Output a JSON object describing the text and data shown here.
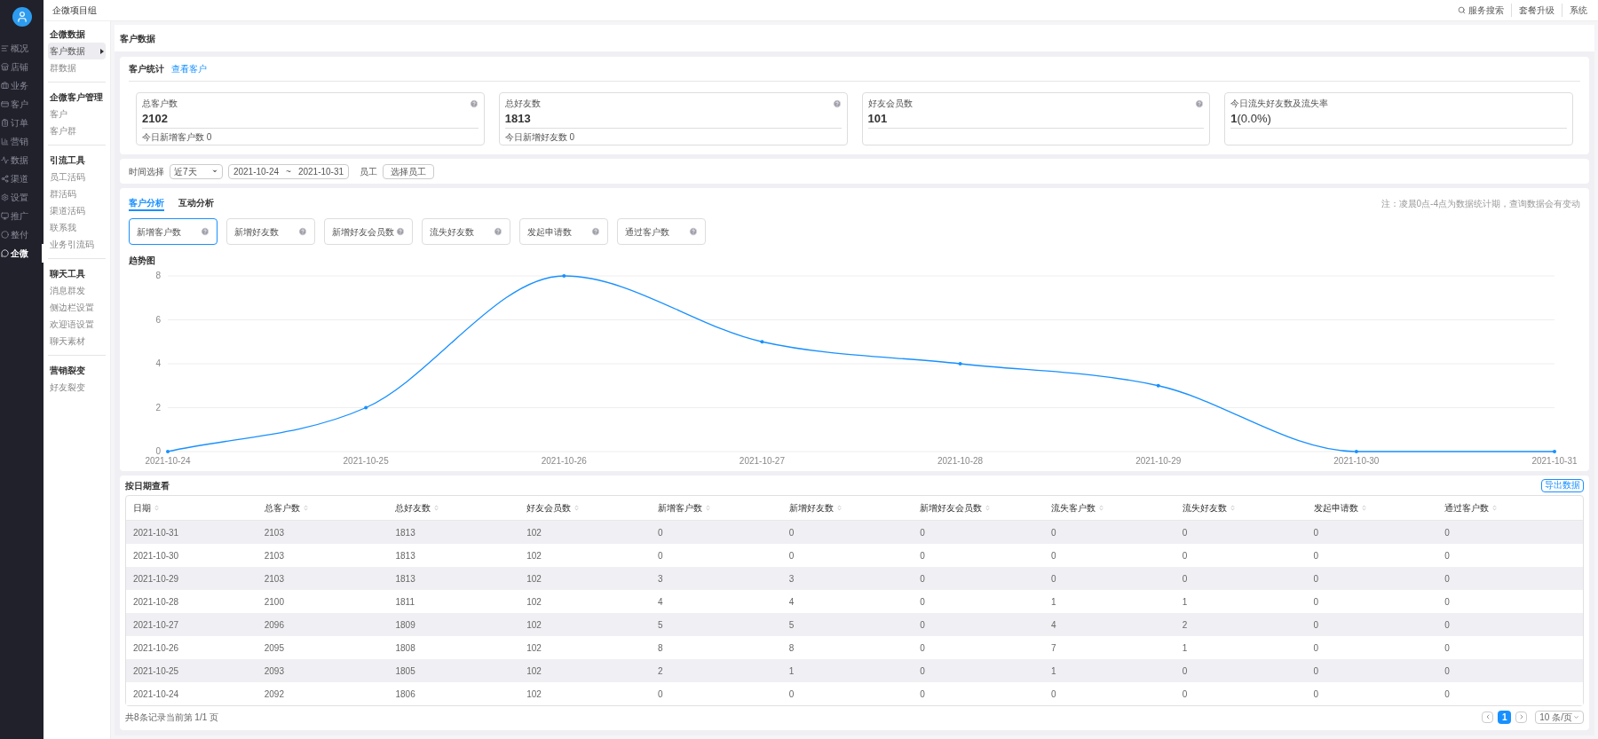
{
  "app_sidebar": {
    "items": [
      {
        "label": "概况",
        "selected": false
      },
      {
        "label": "店铺",
        "selected": false
      },
      {
        "label": "业务",
        "selected": false
      },
      {
        "label": "客户",
        "selected": false
      },
      {
        "label": "订单",
        "selected": false
      },
      {
        "label": "营销",
        "selected": false
      },
      {
        "label": "数据",
        "selected": false
      },
      {
        "label": "渠道",
        "selected": false
      },
      {
        "label": "设置",
        "selected": false
      },
      {
        "label": "推广",
        "selected": false
      },
      {
        "label": "整付",
        "selected": false
      },
      {
        "label": "企微",
        "selected": true
      }
    ]
  },
  "topbar": {
    "title": "企微项目组",
    "links": [
      "服务搜索",
      "套餐升级",
      "系统"
    ]
  },
  "sub_sidebar": {
    "groups": [
      {
        "title": "企微数据",
        "items": [
          {
            "label": "客户数据",
            "selected": true
          },
          {
            "label": "群数据",
            "selected": false
          }
        ]
      },
      {
        "title": "企微客户管理",
        "items": [
          {
            "label": "客户",
            "selected": false
          },
          {
            "label": "客户群",
            "selected": false
          }
        ]
      },
      {
        "title": "引流工具",
        "items": [
          {
            "label": "员工活码",
            "selected": false
          },
          {
            "label": "群活码",
            "selected": false
          },
          {
            "label": "渠道活码",
            "selected": false
          },
          {
            "label": "联系我",
            "selected": false
          },
          {
            "label": "业务引流码",
            "selected": false
          }
        ]
      },
      {
        "title": "聊天工具",
        "items": [
          {
            "label": "消息群发",
            "selected": false
          },
          {
            "label": "侧边栏设置",
            "selected": false
          },
          {
            "label": "欢迎语设置",
            "selected": false
          },
          {
            "label": "聊天素材",
            "selected": false
          }
        ]
      },
      {
        "title": "营销裂变",
        "items": [
          {
            "label": "好友裂变",
            "selected": false
          }
        ]
      }
    ]
  },
  "page_title": "客户数据",
  "stats": {
    "title": "客户统计",
    "link": "查看客户",
    "cards": [
      {
        "label": "总客户数",
        "value": "2102",
        "sub": "今日新增客户数 0",
        "help": true
      },
      {
        "label": "总好友数",
        "value": "1813",
        "sub": "今日新增好友数 0",
        "help": true
      },
      {
        "label": "好友会员数",
        "value": "101",
        "help": true
      },
      {
        "label": "今日流失好友数及流失率",
        "value": "1",
        "rate": "(0.0%)",
        "help": false
      }
    ]
  },
  "filter": {
    "time_label": "时间选择",
    "period": "近7天",
    "start_date": "2021-10-24",
    "separator": "~",
    "end_date": "2021-10-31",
    "staff_label": "员工",
    "staff_button": "选择员工"
  },
  "analysis": {
    "tabs": [
      {
        "label": "客户分析",
        "selected": true
      },
      {
        "label": "互动分析",
        "selected": false
      }
    ],
    "note": "注：凌晨0点-4点为数据统计期，查询数据会有变动",
    "metrics": [
      {
        "label": "新增客户数",
        "selected": true
      },
      {
        "label": "新增好友数",
        "selected": false
      },
      {
        "label": "新增好友会员数",
        "selected": false
      },
      {
        "label": "流失好友数",
        "selected": false
      },
      {
        "label": "发起申请数",
        "selected": false
      },
      {
        "label": "通过客户数",
        "selected": false
      }
    ],
    "chart_data": {
      "type": "line",
      "title": "趋势图",
      "categories": [
        "2021-10-24",
        "2021-10-25",
        "2021-10-26",
        "2021-10-27",
        "2021-10-28",
        "2021-10-29",
        "2021-10-30",
        "2021-10-31"
      ],
      "values": [
        0,
        2,
        8,
        5,
        4,
        3,
        0,
        0
      ],
      "ylim": [
        0,
        8
      ],
      "yticks": [
        0,
        2,
        4,
        6,
        8
      ],
      "grid": true
    }
  },
  "table": {
    "title": "按日期查看",
    "export_button": "导出数据",
    "columns": [
      "日期",
      "总客户数",
      "总好友数",
      "好友会员数",
      "新增客户数",
      "新增好友数",
      "新增好友会员数",
      "流失客户数",
      "流失好友数",
      "发起申请数",
      "通过客户数"
    ],
    "rows": [
      [
        "2021-10-31",
        "2103",
        "1813",
        "102",
        "0",
        "0",
        "0",
        "0",
        "0",
        "0",
        "0"
      ],
      [
        "2021-10-30",
        "2103",
        "1813",
        "102",
        "0",
        "0",
        "0",
        "0",
        "0",
        "0",
        "0"
      ],
      [
        "2021-10-29",
        "2103",
        "1813",
        "102",
        "3",
        "3",
        "0",
        "0",
        "0",
        "0",
        "0"
      ],
      [
        "2021-10-28",
        "2100",
        "1811",
        "102",
        "4",
        "4",
        "0",
        "1",
        "1",
        "0",
        "0"
      ],
      [
        "2021-10-27",
        "2096",
        "1809",
        "102",
        "5",
        "5",
        "0",
        "4",
        "2",
        "0",
        "0"
      ],
      [
        "2021-10-26",
        "2095",
        "1808",
        "102",
        "8",
        "8",
        "0",
        "7",
        "1",
        "0",
        "0"
      ],
      [
        "2021-10-25",
        "2093",
        "1805",
        "102",
        "2",
        "1",
        "0",
        "1",
        "0",
        "0",
        "0"
      ],
      [
        "2021-10-24",
        "2092",
        "1806",
        "102",
        "0",
        "0",
        "0",
        "0",
        "0",
        "0",
        "0"
      ]
    ],
    "summary": "共8条记录当前第 1/1 页",
    "pages": [
      {
        "label": "1",
        "selected": true
      }
    ],
    "page_size": "10 条/页"
  }
}
